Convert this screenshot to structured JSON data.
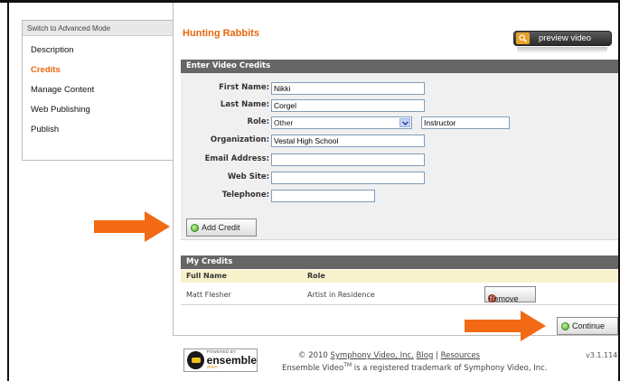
{
  "sidebar": {
    "advanced_mode_label": "Switch to Advanced Mode",
    "items": [
      {
        "label": "Description",
        "active": false
      },
      {
        "label": "Credits",
        "active": true
      },
      {
        "label": "Manage Content",
        "active": false
      },
      {
        "label": "Web Publishing",
        "active": false
      },
      {
        "label": "Publish",
        "active": false
      }
    ]
  },
  "header": {
    "title": "Hunting Rabbits",
    "preview_label": "preview video",
    "preview_icon": "search-icon"
  },
  "credits_form": {
    "panel_title": "Enter Video Credits",
    "first_name": {
      "label": "First Name:",
      "value": "Nikki"
    },
    "last_name": {
      "label": "Last Name:",
      "value": "Corgel"
    },
    "role": {
      "label": "Role:",
      "selected": "Other",
      "other_value": "Instructor"
    },
    "organization": {
      "label": "Organization:",
      "value": "Vestal High School"
    },
    "email": {
      "label": "Email Address:",
      "value": ""
    },
    "website": {
      "label": "Web Site:",
      "value": ""
    },
    "telephone": {
      "label": "Telephone:",
      "value": ""
    },
    "add_button_label": "Add Credit"
  },
  "my_credits": {
    "panel_title": "My Credits",
    "columns": [
      "Full Name",
      "Role"
    ],
    "rows": [
      {
        "full_name": "Matt Flesher",
        "role": "Artist in Residence",
        "action_label": "Remove"
      }
    ]
  },
  "continue_label": "Continue",
  "footer": {
    "copyright_prefix": "© 2010",
    "company_link": "Symphony Video, Inc.",
    "blog_link": "Blog",
    "separator": "|",
    "resources_link": "Resources",
    "trademark_prefix": "Ensemble Video",
    "trademark_sup": "TM",
    "trademark_suffix": "is a registered trademark of Symphony Video, Inc.",
    "version": "v3.1.114",
    "logo": {
      "powered": "POWERED BY",
      "brand": "ensemble",
      "sub": "video"
    }
  },
  "colors": {
    "accent": "#e8660c",
    "header_bar": "#666666",
    "table_head": "#f8f2cc",
    "arrow": "#f26a14"
  }
}
